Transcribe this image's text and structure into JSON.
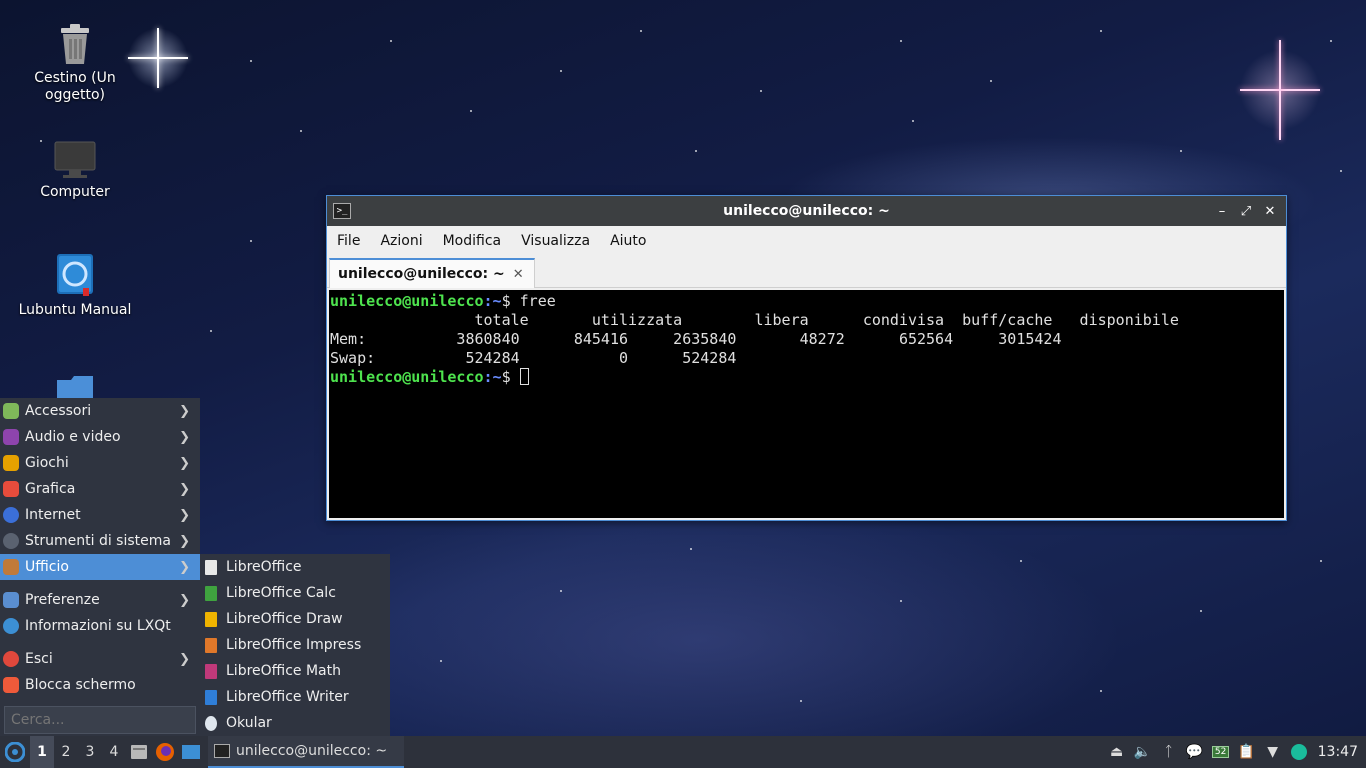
{
  "desktop": {
    "icons": [
      {
        "label": "Cestino (Un oggetto)",
        "icon": "trash-icon"
      },
      {
        "label": "Computer",
        "icon": "computer-icon"
      },
      {
        "label": "Lubuntu Manual",
        "icon": "manual-icon"
      },
      {
        "label": "",
        "icon": "folder-icon"
      }
    ]
  },
  "terminal": {
    "title": "unilecco@unilecco: ~",
    "menu": [
      "File",
      "Azioni",
      "Modifica",
      "Visualizza",
      "Aiuto"
    ],
    "tab_label": "unilecco@unilecco: ~",
    "prompt_user": "unilecco@unilecco",
    "prompt_path": ":~",
    "prompt_sign": "$ ",
    "command": "free",
    "output": [
      "                totale       utilizzata        libera      condivisa  buff/cache   disponibile",
      "Mem:          3860840      845416     2635840       48272      652564     3015424",
      "Swap:          524284           0      524284"
    ]
  },
  "start_menu": {
    "items": [
      {
        "label": "Accessori",
        "submenu": true,
        "color": "#7fb85a"
      },
      {
        "label": "Audio e video",
        "submenu": true,
        "color": "#8e44ad"
      },
      {
        "label": "Giochi",
        "submenu": true,
        "color": "#e6a100"
      },
      {
        "label": "Grafica",
        "submenu": true,
        "color": "#e74c3c"
      },
      {
        "label": "Internet",
        "submenu": true,
        "color": "#3b6fd8"
      },
      {
        "label": "Strumenti di sistema",
        "submenu": true,
        "color": "#5a6270"
      },
      {
        "label": "Ufficio",
        "submenu": true,
        "color": "#c07a3a",
        "selected": true
      },
      {
        "label": "Preferenze",
        "submenu": true,
        "color": "#5a8ed0"
      },
      {
        "label": "Informazioni su LXQt",
        "submenu": false,
        "color": "#3c8fd4"
      },
      {
        "label": "Esci",
        "submenu": true,
        "color": "#e0483c"
      },
      {
        "label": "Blocca schermo",
        "submenu": false,
        "color": "#ef5a3a"
      }
    ],
    "search_placeholder": "Cerca..."
  },
  "office_submenu": {
    "items": [
      {
        "label": "LibreOffice",
        "color": "#e8e8e8"
      },
      {
        "label": "LibreOffice Calc",
        "color": "#3fa33f"
      },
      {
        "label": "LibreOffice Draw",
        "color": "#f0b400"
      },
      {
        "label": "LibreOffice Impress",
        "color": "#e0782a"
      },
      {
        "label": "LibreOffice Math",
        "color": "#c0397a"
      },
      {
        "label": "LibreOffice Writer",
        "color": "#2f7ed8"
      },
      {
        "label": "Okular",
        "color": "#dfe6ee"
      }
    ]
  },
  "taskbar": {
    "workspaces": [
      "1",
      "2",
      "3",
      "4"
    ],
    "active_workspace": "1",
    "task_label": "unilecco@unilecco: ~",
    "battery_label": "52",
    "clock": "13:47"
  }
}
